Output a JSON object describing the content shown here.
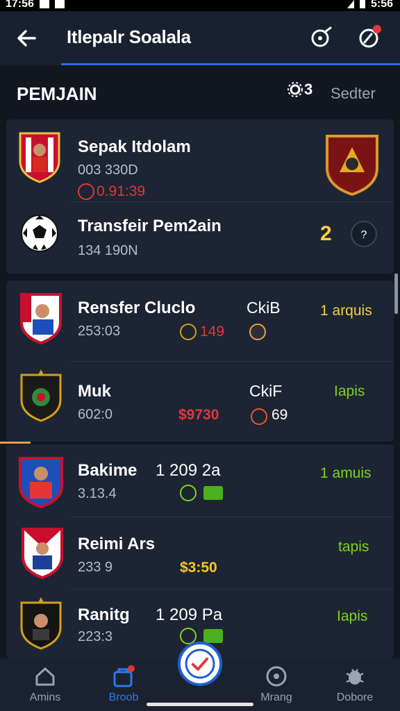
{
  "status_bar": {
    "time_left": "17:56",
    "time_right": "5:56"
  },
  "app_bar": {
    "title": "Itlepalr Soalala",
    "back_icon": "arrow-left-icon",
    "action1_icon": "whistle-icon",
    "action2_icon": "compass-icon"
  },
  "section": {
    "title": "PEMJAIN",
    "settings_label": "3",
    "sorter_label": "Sedter"
  },
  "cards": [
    {
      "rows": [
        {
          "name": "Sepak Itdolam",
          "sub": "003 330D",
          "value": "0.91:39",
          "value_color": "#e53636"
        },
        {
          "name": "Transfeir Pem2ain",
          "sub": "134 190N",
          "count": "2"
        }
      ]
    },
    {
      "rows": [
        {
          "name": "Rensfer  Cluclo",
          "sub": "253:03",
          "value": "149",
          "club": "CkiB",
          "status": "1 arquis"
        },
        {
          "name": "Muk",
          "sub": "602:0",
          "value": "$9730",
          "club": "CkiF",
          "meta": "69",
          "status": "Iapis"
        }
      ]
    },
    {
      "rows": [
        {
          "name": "Bakime",
          "extra": "1 209 2a",
          "sub": "3.13.4",
          "status": "1 amuis"
        },
        {
          "name": "Reimi Ars",
          "sub": "233 9",
          "value": "$3:50",
          "status": "tapis"
        },
        {
          "name": "Ranitg",
          "extra": "1 209 Pa",
          "sub": "223:3",
          "status": "Iapis"
        }
      ]
    }
  ],
  "bottom_nav": [
    {
      "label": "Amins",
      "icon": "home-icon"
    },
    {
      "label": "Broob",
      "icon": "shop-icon"
    },
    {
      "label": "Mrang",
      "icon": "target-icon"
    },
    {
      "label": "Dobore",
      "icon": "bug-icon"
    }
  ],
  "colors": {
    "accent": "#2e6fd8",
    "card_bg": "#1d2534",
    "bg": "#121722",
    "red": "#e53636",
    "green": "#7ed321"
  }
}
